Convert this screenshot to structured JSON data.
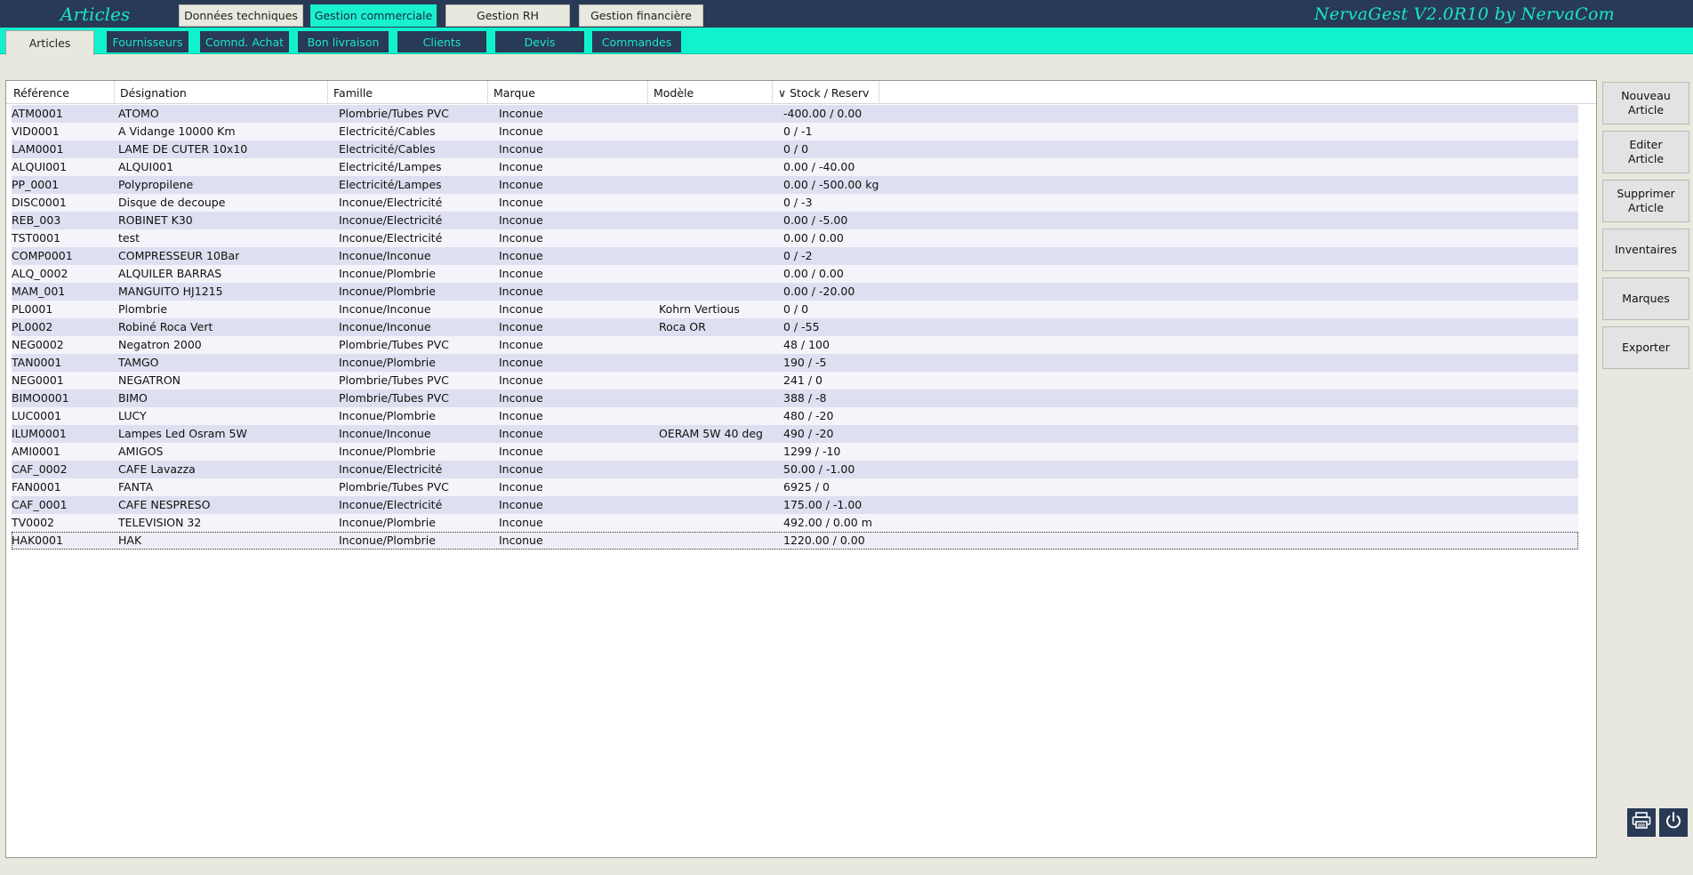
{
  "header": {
    "section_title": "Articles",
    "brand": "NervaGest V2.0R10 by NervaCom",
    "module_tabs": [
      {
        "label": "Données techniques"
      },
      {
        "label": "Gestion commerciale"
      },
      {
        "label": "Gestion RH"
      },
      {
        "label": "Gestion financière"
      }
    ]
  },
  "subtabs": [
    {
      "label": "Articles"
    },
    {
      "label": "Fournisseurs"
    },
    {
      "label": "Comnd. Achat"
    },
    {
      "label": "Bon livraison"
    },
    {
      "label": "Clients"
    },
    {
      "label": "Devis"
    },
    {
      "label": "Commandes"
    }
  ],
  "table": {
    "columns": [
      "Référence",
      "Désignation",
      "Famille",
      "Marque",
      "Modèle",
      "∨ Stock / Reserv"
    ],
    "rows": [
      [
        "ATM0001",
        "ATOMO",
        "Plombrie/Tubes PVC",
        "Inconue",
        "",
        "-400.00 / 0.00"
      ],
      [
        "VID0001",
        "A Vidange 10000 Km",
        "Electricité/Cables",
        "Inconue",
        "",
        "0 / -1"
      ],
      [
        "LAM0001",
        "LAME DE CUTER 10x10",
        "Electricité/Cables",
        "Inconue",
        "",
        "0 / 0"
      ],
      [
        "ALQUI001",
        "ALQUI001",
        "Electricité/Lampes",
        "Inconue",
        "",
        "0.00 / -40.00"
      ],
      [
        "PP_0001",
        "Polypropilene",
        "Electricité/Lampes",
        "Inconue",
        "",
        "0.00 / -500.00 kg"
      ],
      [
        "DISC0001",
        "Disque de decoupe",
        "Inconue/Electricité",
        "Inconue",
        "",
        "0 / -3"
      ],
      [
        "REB_003",
        "ROBINET K30",
        "Inconue/Electricité",
        "Inconue",
        "",
        "0.00 / -5.00"
      ],
      [
        "TST0001",
        "test",
        "Inconue/Electricité",
        "Inconue",
        "",
        "0.00 / 0.00"
      ],
      [
        "COMP0001",
        "COMPRESSEUR 10Bar",
        "Inconue/Inconue",
        "Inconue",
        "",
        "0 / -2"
      ],
      [
        "ALQ_0002",
        "ALQUILER BARRAS",
        "Inconue/Plombrie",
        "Inconue",
        "",
        "0.00 / 0.00"
      ],
      [
        "MAM_001",
        "MANGUITO HJ1215",
        "Inconue/Plombrie",
        "Inconue",
        "",
        "0.00 / -20.00"
      ],
      [
        "PL0001",
        "Plombrie",
        "Inconue/Inconue",
        "Inconue",
        "Kohrn Vertious",
        "0 / 0"
      ],
      [
        "PL0002",
        "Robiné Roca Vert",
        "Inconue/Inconue",
        "Inconue",
        "Roca OR",
        "0 / -55"
      ],
      [
        "NEG0002",
        "Negatron 2000",
        "Plombrie/Tubes PVC",
        "Inconue",
        "",
        "48 / 100"
      ],
      [
        "TAN0001",
        "TAMGO",
        "Inconue/Plombrie",
        "Inconue",
        "",
        "190 / -5"
      ],
      [
        "NEG0001",
        "NEGATRON",
        "Plombrie/Tubes PVC",
        "Inconue",
        "",
        "241 / 0"
      ],
      [
        "BIMO0001",
        "BIMO",
        "Plombrie/Tubes PVC",
        "Inconue",
        "",
        "388 / -8"
      ],
      [
        "LUC0001",
        "LUCY",
        "Inconue/Plombrie",
        "Inconue",
        "",
        "480 / -20"
      ],
      [
        "ILUM0001",
        "Lampes Led Osram 5W",
        "Inconue/Inconue",
        "Inconue",
        "OERAM 5W 40 deg",
        "490 / -20"
      ],
      [
        "AMI0001",
        "AMIGOS",
        "Inconue/Plombrie",
        "Inconue",
        "",
        "1299 / -10"
      ],
      [
        "CAF_0002",
        "CAFE Lavazza",
        "Inconue/Electricité",
        "Inconue",
        "",
        "50.00 / -1.00"
      ],
      [
        "FAN0001",
        "FANTA",
        "Plombrie/Tubes PVC",
        "Inconue",
        "",
        "6925 / 0"
      ],
      [
        "CAF_0001",
        "CAFE NESPRESO",
        "Inconue/Electricité",
        "Inconue",
        "",
        "175.00 / -1.00"
      ],
      [
        "TV0002",
        "TELEVISION 32",
        "Inconue/Plombrie",
        "Inconue",
        "",
        "492.00 / 0.00 m"
      ],
      [
        "HAK0001",
        "HAK",
        "Inconue/Plombrie",
        "Inconue",
        "",
        "1220.00 / 0.00"
      ]
    ]
  },
  "actions": [
    {
      "label": "Nouveau\nArticle"
    },
    {
      "label": "Editer\nArticle"
    },
    {
      "label": "Supprimer\nArticle"
    },
    {
      "label": "Inventaires"
    },
    {
      "label": "Marques"
    },
    {
      "label": "Exporter"
    }
  ],
  "icons": {
    "print": "printer-icon",
    "power": "power-icon"
  }
}
